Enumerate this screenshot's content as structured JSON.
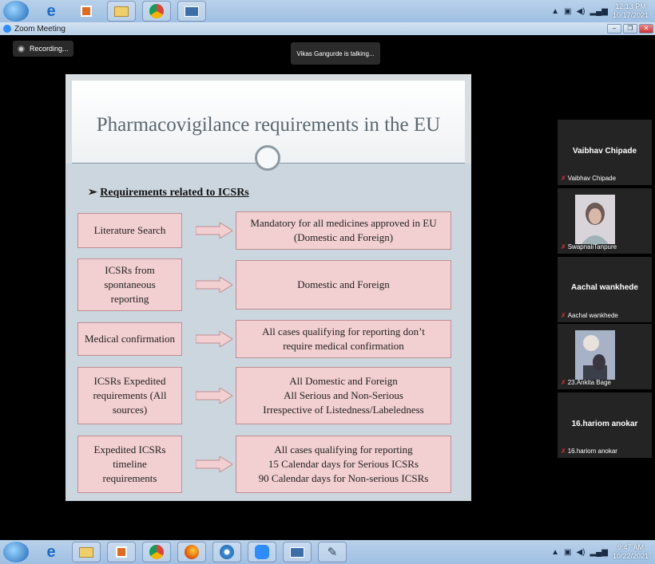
{
  "top_taskbar": {
    "clock_time": "12:13 PM",
    "clock_date": "10/17/2021"
  },
  "window": {
    "title": "Zoom Meeting"
  },
  "recording_label": "Recording...",
  "speaker_banner": "Vikas Gangurde is talking...",
  "slide": {
    "title": "Pharmacovigilance requirements in the EU",
    "section_marker": "➢",
    "section_heading": "Requirements related to ICSRs",
    "rows": [
      {
        "left": "Literature Search",
        "right": "Mandatory for all medicines approved in EU\n(Domestic and Foreign)"
      },
      {
        "left": "ICSRs from\nspontaneous\nreporting",
        "right": "Domestic and Foreign"
      },
      {
        "left": "Medical confirmation",
        "right": "All cases qualifying for reporting don’t\nrequire medical confirmation"
      },
      {
        "left": "ICSRs Expedited\nrequirements (All\nsources)",
        "right": "All Domestic and Foreign\nAll Serious and Non-Serious\nIrrespective of Listedness/Labeledness"
      },
      {
        "left": "Expedited ICSRs\ntimeline\nrequirements",
        "right": "All cases qualifying for reporting\n15 Calendar days for Serious ICSRs\n90 Calendar days for Non-serious ICSRs"
      }
    ]
  },
  "participants": [
    {
      "display_name": "Vaibhav Chipade",
      "label": "Vaibhav Chipade",
      "has_video": false
    },
    {
      "display_name": "",
      "label": "SwapnaliTanpure",
      "has_video": true
    },
    {
      "display_name": "Aachal wankhede",
      "label": "Aachal wankhede",
      "has_video": false
    },
    {
      "display_name": "",
      "label": "23.Ankita Bage",
      "has_video": true
    },
    {
      "display_name": "16.hariom anokar",
      "label": "16.hariom anokar",
      "has_video": false
    }
  ],
  "bottom_taskbar": {
    "clock_time": "9:47 AM",
    "clock_date": "10/22/2021"
  },
  "colors": {
    "box_fill": "#f2cfd0",
    "arrow_fill": "#f2cfd0",
    "muted_mic": "#e0353a"
  }
}
